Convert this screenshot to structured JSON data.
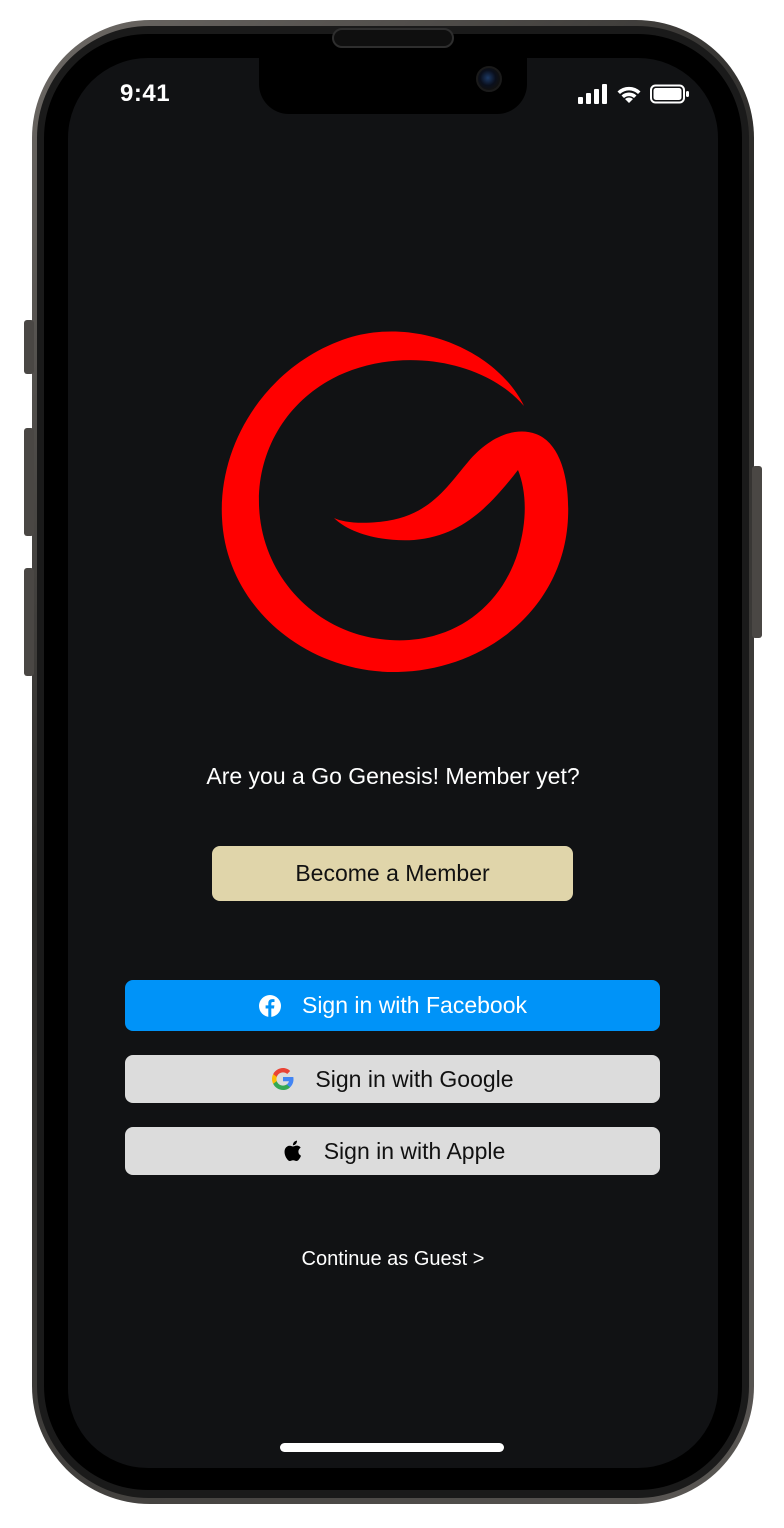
{
  "status_bar": {
    "time": "9:41",
    "icons": [
      "cellular-signal-icon",
      "wifi-icon",
      "battery-icon"
    ]
  },
  "logo": {
    "icon": "go-genesis-swirl-logo",
    "color": "#ff0000"
  },
  "prompt": {
    "text": "Are you a Go Genesis! Member yet?"
  },
  "buttons": {
    "become_member": "Become a Member",
    "facebook": "Sign in with Facebook",
    "google": "Sign in with Google",
    "apple": "Sign in with Apple"
  },
  "guest": {
    "label": "Continue as Guest >"
  },
  "colors": {
    "background": "#111214",
    "member_button": "#e0d5aa",
    "facebook_button": "#0093f8",
    "social_button": "#dcdcdc",
    "logo_red": "#ff0000"
  }
}
